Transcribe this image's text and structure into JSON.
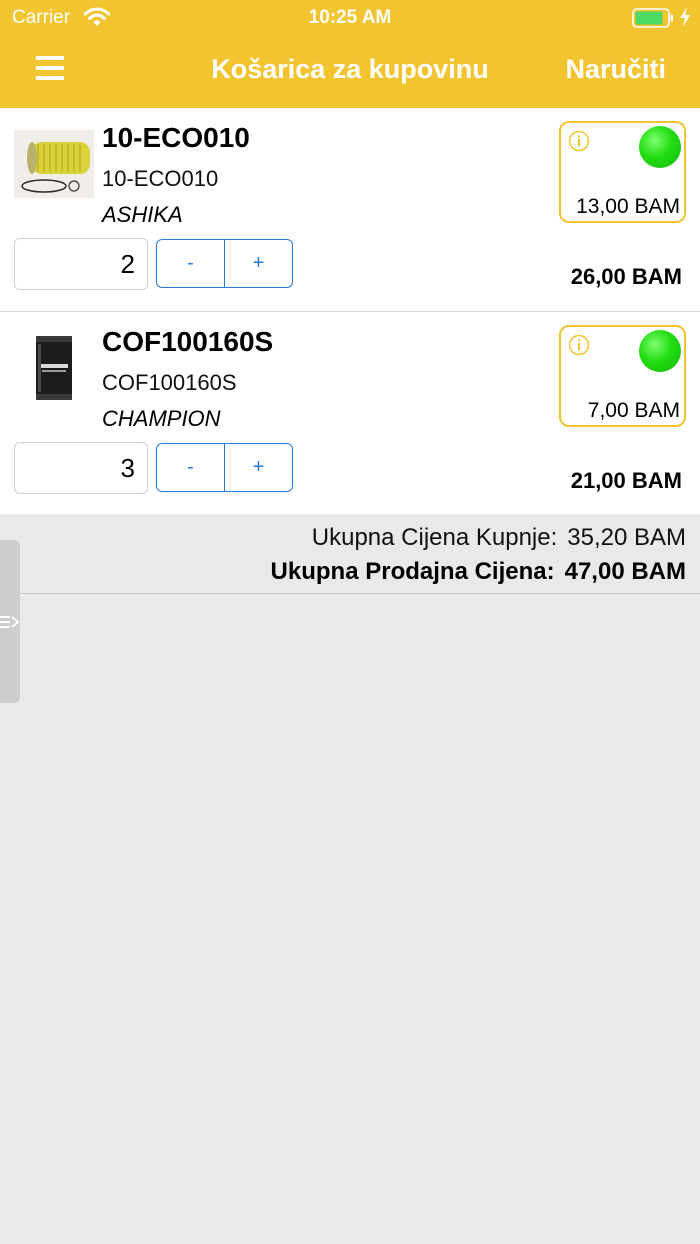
{
  "status_bar": {
    "carrier": "Carrier",
    "time": "10:25 AM"
  },
  "header": {
    "title": "Košarica za kupovinu",
    "order_label": "Naručiti"
  },
  "items": [
    {
      "title": "10-ECO010",
      "code": "10-ECO010",
      "brand": "ASHIKA",
      "quantity": "2",
      "minus": "-",
      "plus": "+",
      "unit_price": "13,00 BAM",
      "total": "26,00 BAM"
    },
    {
      "title": "COF100160S",
      "code": "COF100160S",
      "brand": "CHAMPION",
      "quantity": "3",
      "minus": "-",
      "plus": "+",
      "unit_price": "7,00 BAM",
      "total": "21,00 BAM"
    }
  ],
  "summary": {
    "purchase_label": "Ukupna Cijena Kupnje:",
    "purchase_value": "35,20 BAM",
    "sale_label": "Ukupna Prodajna Cijena:",
    "sale_value": "47,00 BAM"
  },
  "colors": {
    "header": "#f2c42f",
    "accent": "#2a7bd6",
    "availability": "#22dd12"
  }
}
